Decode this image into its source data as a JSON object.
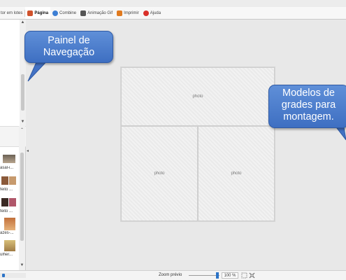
{
  "toolbar": {
    "tabs": [
      {
        "label": "tor em lotes",
        "icon": "batch-icon",
        "color": "#7a7a7a"
      },
      {
        "label": "Página",
        "icon": "page-icon",
        "color": "#d0522c"
      },
      {
        "label": "Combine",
        "icon": "combine-icon",
        "color": "#3d7fd4"
      },
      {
        "label": "Animação Gif",
        "icon": "animation-icon",
        "color": "#555555"
      },
      {
        "label": "Imprimir",
        "icon": "print-icon",
        "color": "#e07a1f"
      },
      {
        "label": "Ajuda",
        "icon": "help-icon",
        "color": "#d9302a"
      }
    ],
    "active_tab": "Página"
  },
  "thumbnails": [
    {
      "label": "asal-i..."
    },
    {
      "label": "feito ..."
    },
    {
      "label": "feito ..."
    },
    {
      "label": "azes-..."
    },
    {
      "label": "ulher..."
    }
  ],
  "canvas": {
    "cells": [
      {
        "label": "photo"
      },
      {
        "label": "photo"
      },
      {
        "label": "photo"
      }
    ]
  },
  "statusbar": {
    "zoom_label": "Zoom prévio",
    "zoom_value": "100 %",
    "zoom_fraction": 0.9
  },
  "callouts": {
    "nav_panel": "Painel de Navegação",
    "grid_models": "Modelos de grades para montagem."
  },
  "colors": {
    "callout": "#4a7acb",
    "accent": "#2b73c7"
  }
}
